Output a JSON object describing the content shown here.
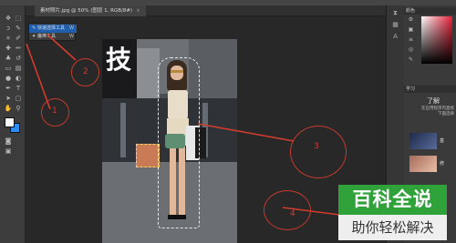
{
  "document": {
    "tab_title": "素材照片.jpg @ 50% (图层 1, RGB/8#)",
    "close_glyph": "×"
  },
  "tool_popup": {
    "items": [
      {
        "label": "快速选择工具",
        "shortcut": "W",
        "selected": true,
        "icon": "quick-selection-icon"
      },
      {
        "label": "魔棒工具",
        "shortcut": "W",
        "selected": false,
        "icon": "magic-wand-icon"
      }
    ]
  },
  "toolbar": {
    "tools": [
      {
        "name": "move-tool",
        "glyph": "✥"
      },
      {
        "name": "marquee-tool",
        "glyph": "⬚"
      },
      {
        "name": "lasso-tool",
        "glyph": "ↄ"
      },
      {
        "name": "quick-selection-tool",
        "glyph": "✎"
      },
      {
        "name": "crop-tool",
        "glyph": "⌗"
      },
      {
        "name": "eyedropper-tool",
        "glyph": "✐"
      },
      {
        "name": "healing-brush-tool",
        "glyph": "✚"
      },
      {
        "name": "brush-tool",
        "glyph": "✏"
      },
      {
        "name": "clone-stamp-tool",
        "glyph": "♣"
      },
      {
        "name": "history-brush-tool",
        "glyph": "↺"
      },
      {
        "name": "eraser-tool",
        "glyph": "▭"
      },
      {
        "name": "gradient-tool",
        "glyph": "▤"
      },
      {
        "name": "blur-tool",
        "glyph": "●"
      },
      {
        "name": "dodge-tool",
        "glyph": "◐"
      },
      {
        "name": "pen-tool",
        "glyph": "✒"
      },
      {
        "name": "type-tool",
        "glyph": "T"
      },
      {
        "name": "path-selection-tool",
        "glyph": "➤"
      },
      {
        "name": "rectangle-tool",
        "glyph": "▢"
      },
      {
        "name": "hand-tool",
        "glyph": "✋"
      },
      {
        "name": "zoom-tool",
        "glyph": "⚲"
      }
    ],
    "foreground_color": "#ffffff",
    "background_color": "#2d8ef0"
  },
  "photo": {
    "sign_text": "技"
  },
  "callouts": [
    "1",
    "2",
    "3",
    "4"
  ],
  "panels": {
    "color_tab": "颜色",
    "learn_tab": "学习",
    "learn_title": "了解",
    "learn_text_1": "在应用程序内直接",
    "learn_text_2": "下面选择"
  },
  "thumbnail_labels": [
    "基",
    "修"
  ],
  "watermark": {
    "top": "百科全说",
    "bottom": "助你轻松解决"
  },
  "colors": {
    "callout_red": "#d23c2e",
    "selection_blue": "#1f5fae",
    "watermark_green": "#2fa23a"
  }
}
